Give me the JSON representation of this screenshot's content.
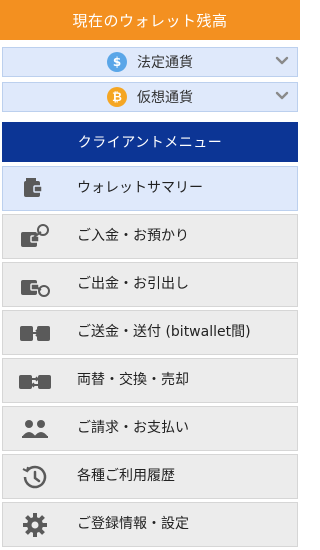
{
  "wallet_header": {
    "title": "現在のウォレット残高"
  },
  "currencies": [
    {
      "label": "法定通貨",
      "coin_symbol": "$",
      "coin_color": "#5aa6e8",
      "icon": "dollar-coin-icon"
    },
    {
      "label": "仮想通貨",
      "coin_symbol": "₿",
      "coin_color": "#f5a623",
      "icon": "bitcoin-coin-icon"
    }
  ],
  "client_menu": {
    "title": "クライアントメニュー",
    "items": [
      {
        "label": "ウォレットサマリー",
        "icon": "wallet-icon",
        "active": true
      },
      {
        "label": "ご入金・お預かり",
        "icon": "wallet-deposit-icon",
        "active": false
      },
      {
        "label": "ご出金・お引出し",
        "icon": "wallet-withdraw-icon",
        "active": false
      },
      {
        "label": "ご送金・送付 (bitwallet間)",
        "icon": "wallet-transfer-icon",
        "active": false
      },
      {
        "label": "両替・交換・売却",
        "icon": "exchange-icon",
        "active": false
      },
      {
        "label": "ご請求・お支払い",
        "icon": "users-icon",
        "active": false
      },
      {
        "label": "各種ご利用履歴",
        "icon": "history-icon",
        "active": false
      },
      {
        "label": "ご登録情報・設定",
        "icon": "gear-icon",
        "active": false
      }
    ]
  },
  "colors": {
    "orange": "#f39020",
    "navy": "#0c3595",
    "active_bg": "#dfe9fb",
    "item_bg": "#ececec",
    "icon": "#5a5a5a"
  }
}
